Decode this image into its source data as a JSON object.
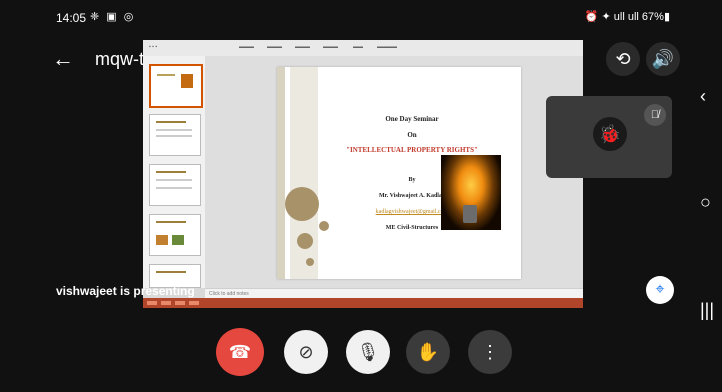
{
  "status_bar": {
    "time": "14:05",
    "left_icons": "❈ ▣ ◎",
    "right_text": "⏰ ✦ ull ull 67%▮"
  },
  "meeting": {
    "title": "mqw-tgbs-pmc",
    "presenting_text": "vishwajeet is presenting"
  },
  "slide": {
    "line1": "One Day Seminar",
    "line2": "On",
    "title": "\"INTELLECTUAL PROPERTY RIGHTS\"",
    "by": "By",
    "author": "Mr. Vishwajeet A. Kadlag",
    "email": "kadlagvishwajeet@gmail.com",
    "department": "ME Civil-Structures",
    "notes_placeholder": "Click to add notes"
  },
  "icons": {
    "back": "arrow-back-icon",
    "switch_camera": "switch-camera-icon",
    "speaker": "speaker-icon",
    "end_call": "call-end-icon",
    "camera_off": "camera-off-icon",
    "mic_off": "mic-off-icon",
    "raise_hand": "raise-hand-icon",
    "more": "more-vert-icon",
    "pin": "pin-icon"
  },
  "colors": {
    "end_call": "#e5483f",
    "slide_title": "#c0392b",
    "accent": "#1a73e8"
  }
}
